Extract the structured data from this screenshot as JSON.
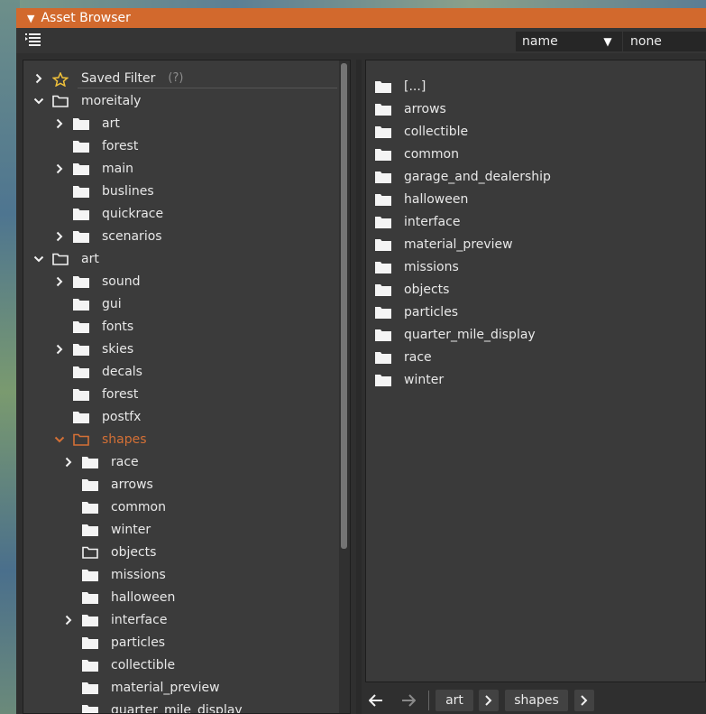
{
  "window": {
    "title": "Asset Browser"
  },
  "toolbar": {
    "sort_field": "name",
    "filter_field": "none"
  },
  "tree": {
    "items": [
      {
        "label": "Saved Filter",
        "hint": "(?)",
        "indent": 0,
        "chevron": "right",
        "icon": "star"
      },
      {
        "label": "moreitaly",
        "indent": 0,
        "chevron": "down",
        "icon": "folder-outline"
      },
      {
        "label": "art",
        "indent": 1,
        "chevron": "right",
        "icon": "folder"
      },
      {
        "label": "forest",
        "indent": 1,
        "chevron": "none",
        "icon": "folder"
      },
      {
        "label": "main",
        "indent": 1,
        "chevron": "right",
        "icon": "folder"
      },
      {
        "label": "buslines",
        "indent": 1,
        "chevron": "none",
        "icon": "folder"
      },
      {
        "label": "quickrace",
        "indent": 1,
        "chevron": "none",
        "icon": "folder"
      },
      {
        "label": "scenarios",
        "indent": 1,
        "chevron": "right",
        "icon": "folder"
      },
      {
        "label": "art",
        "indent": 0,
        "chevron": "down",
        "icon": "folder-outline"
      },
      {
        "label": "sound",
        "indent": 1,
        "chevron": "right",
        "icon": "folder"
      },
      {
        "label": "gui",
        "indent": 1,
        "chevron": "none",
        "icon": "folder"
      },
      {
        "label": "fonts",
        "indent": 1,
        "chevron": "none",
        "icon": "folder"
      },
      {
        "label": "skies",
        "indent": 1,
        "chevron": "right",
        "icon": "folder"
      },
      {
        "label": "decals",
        "indent": 1,
        "chevron": "none",
        "icon": "folder"
      },
      {
        "label": "forest",
        "indent": 1,
        "chevron": "none",
        "icon": "folder"
      },
      {
        "label": "postfx",
        "indent": 1,
        "chevron": "none",
        "icon": "folder"
      },
      {
        "label": "shapes",
        "indent": 1,
        "chevron": "down",
        "icon": "folder-outline",
        "selected": true
      },
      {
        "label": "race",
        "indent": 2,
        "chevron": "right",
        "icon": "folder"
      },
      {
        "label": "arrows",
        "indent": 2,
        "chevron": "none",
        "icon": "folder"
      },
      {
        "label": "common",
        "indent": 2,
        "chevron": "none",
        "icon": "folder"
      },
      {
        "label": "winter",
        "indent": 2,
        "chevron": "none",
        "icon": "folder"
      },
      {
        "label": "objects",
        "indent": 2,
        "chevron": "none",
        "icon": "folder-outline"
      },
      {
        "label": "missions",
        "indent": 2,
        "chevron": "none",
        "icon": "folder"
      },
      {
        "label": "halloween",
        "indent": 2,
        "chevron": "none",
        "icon": "folder"
      },
      {
        "label": "interface",
        "indent": 2,
        "chevron": "right",
        "icon": "folder"
      },
      {
        "label": "particles",
        "indent": 2,
        "chevron": "none",
        "icon": "folder"
      },
      {
        "label": "collectible",
        "indent": 2,
        "chevron": "none",
        "icon": "folder"
      },
      {
        "label": "material_preview",
        "indent": 2,
        "chevron": "none",
        "icon": "folder"
      },
      {
        "label": "quarter_mile_display",
        "indent": 2,
        "chevron": "none",
        "icon": "folder"
      }
    ]
  },
  "list": {
    "items": [
      "[...]",
      "arrows",
      "collectible",
      "common",
      "garage_and_dealership",
      "halloween",
      "interface",
      "material_preview",
      "missions",
      "objects",
      "particles",
      "quarter_mile_display",
      "race",
      "winter"
    ]
  },
  "breadcrumb": {
    "items": [
      "art",
      "shapes"
    ]
  },
  "colors": {
    "accent": "#d2692d",
    "selected_text": "#d47036",
    "star": "#f2c23a"
  }
}
